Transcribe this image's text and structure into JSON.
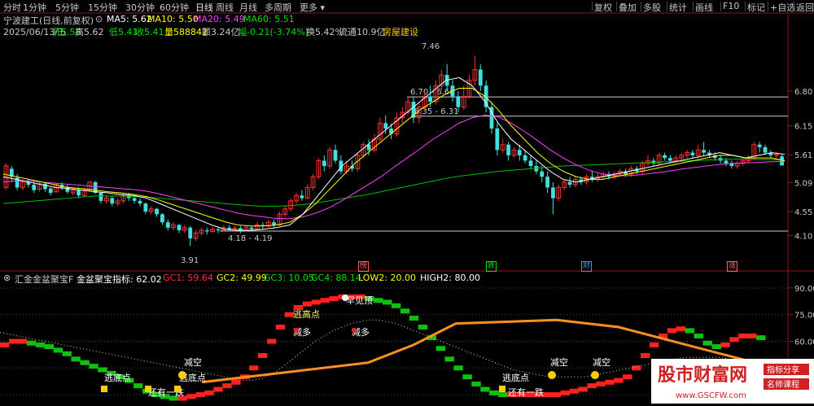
{
  "toolbar": {
    "periods": [
      {
        "label": "分时",
        "active": false
      },
      {
        "label": "1分钟",
        "active": false
      },
      {
        "label": "5分钟",
        "active": false
      },
      {
        "label": "15分钟",
        "active": false
      },
      {
        "label": "30分钟",
        "active": false
      },
      {
        "label": "60分钟",
        "active": false
      },
      {
        "label": "日线",
        "active": true
      },
      {
        "label": "周线",
        "active": false
      },
      {
        "label": "月线",
        "active": false
      },
      {
        "label": "多周期",
        "active": false
      },
      {
        "label": "更多",
        "active": false
      }
    ],
    "right_buttons": [
      "复权",
      "叠加",
      "多股",
      "统计",
      "画线",
      "F10",
      "标记",
      "+自选",
      "返回"
    ]
  },
  "stock": {
    "title": "宁波建工(日线,前复权)",
    "ma_labels": [
      {
        "text": "MA5: 5.62",
        "color": "#ffffff"
      },
      {
        "text": "MA10: 5.50",
        "color": "#ffff00"
      },
      {
        "text": "MA20: 5.49",
        "color": "#ff40ff"
      },
      {
        "text": "MA60: 5.51",
        "color": "#00e000"
      }
    ],
    "info_line": [
      {
        "text": "2025/06/13/五",
        "color": "#c8c8c8"
      },
      {
        "text": "开5.58",
        "color": "#00e000"
      },
      {
        "text": "高5.62",
        "color": "#c8c8c8"
      },
      {
        "text": "低5.41",
        "color": "#00e000"
      },
      {
        "text": "收5.41",
        "color": "#00e000"
      },
      {
        "text": "量588842",
        "color": "#ffff00"
      },
      {
        "text": "额3.24亿",
        "color": "#c8c8c8"
      },
      {
        "text": "幅-0.21(-3.74%)",
        "color": "#00e000"
      },
      {
        "text": "换5.42%",
        "color": "#c8c8c8"
      },
      {
        "text": "流通10.9亿",
        "color": "#c8c8c8"
      },
      {
        "text": "房屋建设",
        "color": "#ffcc00"
      }
    ],
    "price_axis": [
      "6.80",
      "6.15",
      "5.61",
      "5.09",
      "4.55",
      "4.10"
    ],
    "annotations": {
      "high": "7.46",
      "low": "3.91",
      "range1": "6.70 - 6.68",
      "range2": "6.35 - 6.31",
      "range3": "4.18 - 4.19"
    },
    "event_badges": [
      {
        "text": "榜",
        "color": "#ff6060"
      },
      {
        "text": "跌",
        "color": "#00e000"
      },
      {
        "text": "财",
        "color": "#4090ff"
      },
      {
        "text": "涨",
        "color": "#ff6060"
      }
    ]
  },
  "indicator": {
    "name": "汇金金盆聚宝F",
    "values": [
      {
        "text": "金盆聚宝指标: 62.02",
        "color": "#ffffff"
      },
      {
        "text": "GC1: 59.64",
        "color": "#ff3030"
      },
      {
        "text": "GC2: 49.99",
        "color": "#ffff00"
      },
      {
        "text": "GC3: 10.05",
        "color": "#00e000"
      },
      {
        "text": "GC4: 88.14",
        "color": "#00e000"
      },
      {
        "text": "LOW2: 20.00",
        "color": "#ffff00"
      },
      {
        "text": "HIGH2: 80.00",
        "color": "#ffffff"
      }
    ],
    "axis": [
      "90.00",
      "75.00",
      "60.00",
      "45.00"
    ],
    "labels": [
      "逃高点",
      "罕见顶",
      "减多",
      "减多",
      "减空",
      "逃底点",
      "逃底点",
      "还有一跌",
      "逃底点",
      "减空",
      "减空",
      "还有一跌"
    ]
  },
  "chart_data": {
    "type": "candlestick",
    "ylim": [
      3.7,
      7.8
    ],
    "candles": [
      [
        5.0,
        5.4,
        4.95,
        5.45
      ],
      [
        5.35,
        5.2,
        5.1,
        5.4
      ],
      [
        5.18,
        5.0,
        4.95,
        5.25
      ],
      [
        5.0,
        5.1,
        4.95,
        5.15
      ],
      [
        5.1,
        5.05,
        5.0,
        5.15
      ],
      [
        5.05,
        4.95,
        4.9,
        5.1
      ],
      [
        4.97,
        5.07,
        4.92,
        5.1
      ],
      [
        5.07,
        4.97,
        4.92,
        5.1
      ],
      [
        4.98,
        4.9,
        4.85,
        5.0
      ],
      [
        4.92,
        5.05,
        4.9,
        5.08
      ],
      [
        5.05,
        5.0,
        4.95,
        5.1
      ],
      [
        5.0,
        4.92,
        4.88,
        5.05
      ],
      [
        4.9,
        4.95,
        4.85,
        5.0
      ],
      [
        4.95,
        4.85,
        4.8,
        5.0
      ],
      [
        4.85,
        4.95,
        4.82,
        5.0
      ],
      [
        4.95,
        5.1,
        4.92,
        5.12
      ],
      [
        5.1,
        4.9,
        4.88,
        5.12
      ],
      [
        4.9,
        4.75,
        4.7,
        4.92
      ],
      [
        4.75,
        4.8,
        4.7,
        4.85
      ],
      [
        4.8,
        4.7,
        4.65,
        4.85
      ],
      [
        4.7,
        4.75,
        4.65,
        4.8
      ],
      [
        4.75,
        4.85,
        4.7,
        4.9
      ],
      [
        4.85,
        4.8,
        4.75,
        4.9
      ],
      [
        4.8,
        4.75,
        4.7,
        4.85
      ],
      [
        4.75,
        4.7,
        4.65,
        4.8
      ],
      [
        4.7,
        4.55,
        4.5,
        4.72
      ],
      [
        4.55,
        4.6,
        4.5,
        4.65
      ],
      [
        4.6,
        4.5,
        4.45,
        4.62
      ],
      [
        4.5,
        4.35,
        4.3,
        4.52
      ],
      [
        4.35,
        4.25,
        4.2,
        4.4
      ],
      [
        4.25,
        4.3,
        4.2,
        4.35
      ],
      [
        4.3,
        4.2,
        4.15,
        4.32
      ],
      [
        4.2,
        4.25,
        4.15,
        4.3
      ],
      [
        4.25,
        4.05,
        3.91,
        4.28
      ],
      [
        4.05,
        4.15,
        4.0,
        4.2
      ],
      [
        4.15,
        4.2,
        4.1,
        4.25
      ],
      [
        4.2,
        4.18,
        4.12,
        4.25
      ],
      [
        4.18,
        4.22,
        4.15,
        4.26
      ],
      [
        4.22,
        4.2,
        4.15,
        4.25
      ],
      [
        4.2,
        4.25,
        4.18,
        4.3
      ],
      [
        4.25,
        4.22,
        4.18,
        4.3
      ],
      [
        4.22,
        4.24,
        4.18,
        4.28
      ],
      [
        4.24,
        4.2,
        4.15,
        4.28
      ],
      [
        4.2,
        4.25,
        4.18,
        4.3
      ],
      [
        4.25,
        4.22,
        4.18,
        4.28
      ],
      [
        4.22,
        4.3,
        4.2,
        4.35
      ],
      [
        4.3,
        4.28,
        4.22,
        4.35
      ],
      [
        4.28,
        4.35,
        4.25,
        4.4
      ],
      [
        4.35,
        4.3,
        4.25,
        4.4
      ],
      [
        4.3,
        4.5,
        4.28,
        4.55
      ],
      [
        4.5,
        4.6,
        4.45,
        4.65
      ],
      [
        4.6,
        4.75,
        4.55,
        4.8
      ],
      [
        4.75,
        4.85,
        4.7,
        4.9
      ],
      [
        4.85,
        4.8,
        4.75,
        4.95
      ],
      [
        4.8,
        5.0,
        4.78,
        5.05
      ],
      [
        5.0,
        5.2,
        4.95,
        5.25
      ],
      [
        5.2,
        5.5,
        5.15,
        5.55
      ],
      [
        5.5,
        5.4,
        5.3,
        5.6
      ],
      [
        5.4,
        5.7,
        5.35,
        5.75
      ],
      [
        5.7,
        5.5,
        5.45,
        5.8
      ],
      [
        5.5,
        5.3,
        5.25,
        5.6
      ],
      [
        5.3,
        5.4,
        5.25,
        5.5
      ],
      [
        5.4,
        5.35,
        5.3,
        5.5
      ],
      [
        5.35,
        5.6,
        5.3,
        5.65
      ],
      [
        5.6,
        5.8,
        5.55,
        5.85
      ],
      [
        5.8,
        5.7,
        5.6,
        5.9
      ],
      [
        5.7,
        5.9,
        5.65,
        6.0
      ],
      [
        5.9,
        6.2,
        5.85,
        6.3
      ],
      [
        6.2,
        6.1,
        6.0,
        6.35
      ],
      [
        6.1,
        6.0,
        5.9,
        6.2
      ],
      [
        6.0,
        6.3,
        5.95,
        6.4
      ],
      [
        6.3,
        6.4,
        6.2,
        6.5
      ],
      [
        6.4,
        6.6,
        6.35,
        6.7
      ],
      [
        6.6,
        6.3,
        6.2,
        6.7
      ],
      [
        6.3,
        6.5,
        6.2,
        6.6
      ],
      [
        6.5,
        6.7,
        6.45,
        6.8
      ],
      [
        6.7,
        6.6,
        6.5,
        6.9
      ],
      [
        6.6,
        6.9,
        6.55,
        7.0
      ],
      [
        6.9,
        7.1,
        6.8,
        7.2
      ],
      [
        7.1,
        6.9,
        6.8,
        7.3
      ],
      [
        6.9,
        6.7,
        6.6,
        7.0
      ],
      [
        6.7,
        6.5,
        6.4,
        6.8
      ],
      [
        6.5,
        6.7,
        6.45,
        6.9
      ],
      [
        6.7,
        7.0,
        6.65,
        7.1
      ],
      [
        7.0,
        7.2,
        6.9,
        7.46
      ],
      [
        7.2,
        6.9,
        6.8,
        7.3
      ],
      [
        6.9,
        6.5,
        6.4,
        7.0
      ],
      [
        6.5,
        6.1,
        6.0,
        6.6
      ],
      [
        6.1,
        5.7,
        5.6,
        6.2
      ],
      [
        5.7,
        5.8,
        5.65,
        5.9
      ],
      [
        5.8,
        5.6,
        5.5,
        5.85
      ],
      [
        5.6,
        5.7,
        5.55,
        5.75
      ],
      [
        5.7,
        5.6,
        5.5,
        5.8
      ],
      [
        5.6,
        5.5,
        5.45,
        5.7
      ],
      [
        5.5,
        5.4,
        5.35,
        5.6
      ],
      [
        5.4,
        5.3,
        5.25,
        5.5
      ],
      [
        5.3,
        5.2,
        5.1,
        5.4
      ],
      [
        5.2,
        5.0,
        4.9,
        5.3
      ],
      [
        5.0,
        4.8,
        4.5,
        5.1
      ],
      [
        4.8,
        5.0,
        4.75,
        5.05
      ],
      [
        5.0,
        5.1,
        4.95,
        5.15
      ],
      [
        5.1,
        5.05,
        5.0,
        5.2
      ],
      [
        5.05,
        5.15,
        5.0,
        5.2
      ],
      [
        5.15,
        5.1,
        5.05,
        5.2
      ],
      [
        5.1,
        5.2,
        5.05,
        5.25
      ],
      [
        5.2,
        5.15,
        5.1,
        5.3
      ],
      [
        5.15,
        5.2,
        5.1,
        5.28
      ],
      [
        5.2,
        5.25,
        5.15,
        5.3
      ],
      [
        5.25,
        5.2,
        5.15,
        5.3
      ],
      [
        5.2,
        5.25,
        5.15,
        5.3
      ],
      [
        5.25,
        5.3,
        5.2,
        5.35
      ],
      [
        5.3,
        5.25,
        5.2,
        5.35
      ],
      [
        5.25,
        5.35,
        5.2,
        5.4
      ],
      [
        5.35,
        5.3,
        5.25,
        5.4
      ],
      [
        5.3,
        5.45,
        5.25,
        5.5
      ],
      [
        5.45,
        5.5,
        5.4,
        5.6
      ],
      [
        5.5,
        5.45,
        5.4,
        5.55
      ],
      [
        5.45,
        5.6,
        5.4,
        5.65
      ],
      [
        5.6,
        5.55,
        5.5,
        5.65
      ],
      [
        5.55,
        5.5,
        5.45,
        5.6
      ],
      [
        5.5,
        5.55,
        5.45,
        5.6
      ],
      [
        5.55,
        5.6,
        5.5,
        5.65
      ],
      [
        5.6,
        5.65,
        5.55,
        5.7
      ],
      [
        5.65,
        5.6,
        5.55,
        5.7
      ],
      [
        5.6,
        5.7,
        5.55,
        5.8
      ],
      [
        5.7,
        5.65,
        5.6,
        5.85
      ],
      [
        5.65,
        5.6,
        5.55,
        5.7
      ],
      [
        5.6,
        5.55,
        5.5,
        5.65
      ],
      [
        5.55,
        5.5,
        5.45,
        5.6
      ],
      [
        5.5,
        5.45,
        5.4,
        5.55
      ],
      [
        5.45,
        5.4,
        5.35,
        5.5
      ],
      [
        5.4,
        5.45,
        5.35,
        5.5
      ],
      [
        5.45,
        5.5,
        5.4,
        5.55
      ],
      [
        5.5,
        5.55,
        5.45,
        5.6
      ],
      [
        5.55,
        5.8,
        5.5,
        5.85
      ],
      [
        5.8,
        5.75,
        5.65,
        5.85
      ],
      [
        5.75,
        5.65,
        5.6,
        5.8
      ],
      [
        5.65,
        5.6,
        5.55,
        5.7
      ],
      [
        5.6,
        5.62,
        5.55,
        5.65
      ],
      [
        5.58,
        5.41,
        5.41,
        5.62
      ]
    ],
    "ma5": [
      5.2,
      5.15,
      5.1,
      5.05,
      5.0,
      4.98,
      4.95,
      4.92,
      4.9,
      4.87,
      4.85,
      4.8,
      4.7,
      4.6,
      4.5,
      4.4,
      4.3,
      4.22,
      4.2,
      4.2,
      4.22,
      4.25,
      4.3,
      4.5,
      4.8,
      5.1,
      5.4,
      5.6,
      5.8,
      6.0,
      6.2,
      6.4,
      6.6,
      6.8,
      7.0,
      7.05,
      6.9,
      6.6,
      6.2,
      5.9,
      5.7,
      5.5,
      5.3,
      5.15,
      5.1,
      5.15,
      5.2,
      5.25,
      5.3,
      5.35,
      5.4,
      5.45,
      5.5,
      5.55,
      5.6,
      5.65,
      5.6,
      5.55,
      5.6,
      5.65,
      5.62
    ],
    "ma10": [
      5.25,
      5.2,
      5.15,
      5.1,
      5.05,
      5.0,
      4.98,
      4.95,
      4.92,
      4.9,
      4.87,
      4.83,
      4.76,
      4.68,
      4.6,
      4.52,
      4.44,
      4.36,
      4.3,
      4.28,
      4.28,
      4.3,
      4.35,
      4.5,
      4.7,
      4.95,
      5.2,
      5.45,
      5.65,
      5.85,
      6.05,
      6.25,
      6.45,
      6.6,
      6.75,
      6.85,
      6.85,
      6.7,
      6.45,
      6.15,
      5.9,
      5.65,
      5.45,
      5.3,
      5.2,
      5.15,
      5.15,
      5.2,
      5.25,
      5.3,
      5.35,
      5.4,
      5.45,
      5.5,
      5.55,
      5.6,
      5.6,
      5.55,
      5.55,
      5.55,
      5.5
    ],
    "ma20": [
      5.1,
      5.12,
      5.12,
      5.1,
      5.08,
      5.06,
      5.04,
      5.02,
      5.0,
      4.98,
      4.96,
      4.93,
      4.88,
      4.82,
      4.76,
      4.7,
      4.64,
      4.58,
      4.52,
      4.48,
      4.45,
      4.42,
      4.42,
      4.45,
      4.52,
      4.62,
      4.75,
      4.9,
      5.05,
      5.2,
      5.38,
      5.55,
      5.72,
      5.9,
      6.05,
      6.2,
      6.3,
      6.35,
      6.32,
      6.2,
      6.05,
      5.88,
      5.7,
      5.55,
      5.42,
      5.32,
      5.25,
      5.22,
      5.22,
      5.24,
      5.27,
      5.3,
      5.34,
      5.37,
      5.4,
      5.43,
      5.45,
      5.46,
      5.47,
      5.48,
      5.49
    ],
    "ma60": [
      4.7,
      4.72,
      4.74,
      4.76,
      4.78,
      4.8,
      4.82,
      4.84,
      4.84,
      4.84,
      4.83,
      4.82,
      4.8,
      4.78,
      4.76,
      4.74,
      4.72,
      4.7,
      4.68,
      4.66,
      4.65,
      4.65,
      4.66,
      4.68,
      4.71,
      4.75,
      4.79,
      4.83,
      4.87,
      4.92,
      4.97,
      5.02,
      5.07,
      5.12,
      5.17,
      5.21,
      5.24,
      5.27,
      5.3,
      5.32,
      5.34,
      5.36,
      5.38,
      5.4,
      5.41,
      5.42,
      5.43,
      5.44,
      5.45,
      5.46,
      5.47,
      5.48,
      5.49,
      5.5,
      5.51,
      5.52,
      5.53,
      5.53,
      5.52,
      5.52,
      5.51
    ],
    "indicator_ylim": [
      25,
      95
    ],
    "indicator_main": [
      58,
      60,
      60,
      59,
      58,
      57,
      55,
      53,
      50,
      48,
      46,
      44,
      42,
      40,
      38,
      35,
      32,
      30,
      29,
      28,
      28,
      29,
      30,
      31,
      33,
      35,
      37,
      40,
      45,
      52,
      60,
      68,
      75,
      79,
      81,
      82,
      83,
      84,
      85,
      85,
      85,
      84,
      83,
      82,
      80,
      77,
      73,
      68,
      62,
      56,
      50,
      45,
      40,
      36,
      33,
      31,
      30,
      30,
      30,
      30,
      30,
      30,
      30,
      31,
      32,
      33,
      35,
      36,
      37,
      38,
      40,
      45,
      52,
      58,
      63,
      66,
      67,
      66,
      63,
      59,
      57,
      58,
      61,
      63,
      63,
      62
    ],
    "indicator_slow": [
      65,
      64,
      63,
      62,
      61,
      60,
      59,
      58,
      57,
      56,
      55,
      54,
      53,
      52,
      51,
      50,
      49,
      48,
      47,
      46,
      45,
      44,
      43,
      42,
      41,
      40,
      39,
      38,
      38,
      39,
      41,
      44,
      48,
      52,
      56,
      60,
      63,
      66,
      68,
      70,
      71,
      72,
      72,
      71,
      70,
      68,
      66,
      64,
      62,
      60,
      58,
      56,
      54,
      52,
      50,
      48,
      46,
      44,
      43,
      42,
      41,
      40,
      40,
      40,
      40,
      40,
      41,
      42,
      43,
      44,
      45,
      46,
      47,
      48,
      49,
      50,
      51,
      51,
      51,
      51,
      51,
      50,
      50,
      50,
      50,
      50
    ],
    "orange_line": {
      "x": [
        62,
        113,
        127,
        140,
        171,
        190,
        236
      ],
      "y": [
        37,
        48,
        58,
        70,
        72,
        68,
        46
      ]
    },
    "orange_line2": {
      "x": [
        200,
        236
      ],
      "y": [
        40,
        44
      ]
    }
  }
}
